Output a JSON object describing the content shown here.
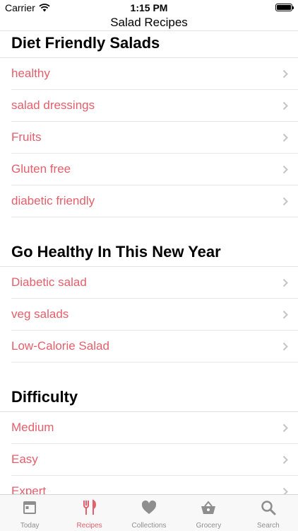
{
  "status_bar": {
    "carrier": "Carrier",
    "time": "1:15 PM"
  },
  "nav": {
    "title": "Salad Recipes"
  },
  "colors": {
    "accent": "#e35f6b",
    "inactive": "#8e8e8e",
    "chevron": "#c4c4c8"
  },
  "sections": [
    {
      "title": "Diet Friendly Salads",
      "items": [
        "healthy",
        "salad dressings",
        "Fruits",
        "Gluten free",
        "diabetic friendly"
      ]
    },
    {
      "title": "Go Healthy In This New Year",
      "items": [
        "Diabetic salad",
        "veg salads",
        "Low-Calorie Salad"
      ]
    },
    {
      "title": "Difficulty",
      "items": [
        "Medium",
        "Easy",
        "Expert"
      ]
    }
  ],
  "tabs": [
    {
      "label": "Today",
      "icon": "calendar-icon"
    },
    {
      "label": "Recipes",
      "icon": "fork-knife-icon",
      "active": true
    },
    {
      "label": "Collections",
      "icon": "heart-icon"
    },
    {
      "label": "Grocery",
      "icon": "basket-icon"
    },
    {
      "label": "Search",
      "icon": "magnifier-icon"
    }
  ]
}
